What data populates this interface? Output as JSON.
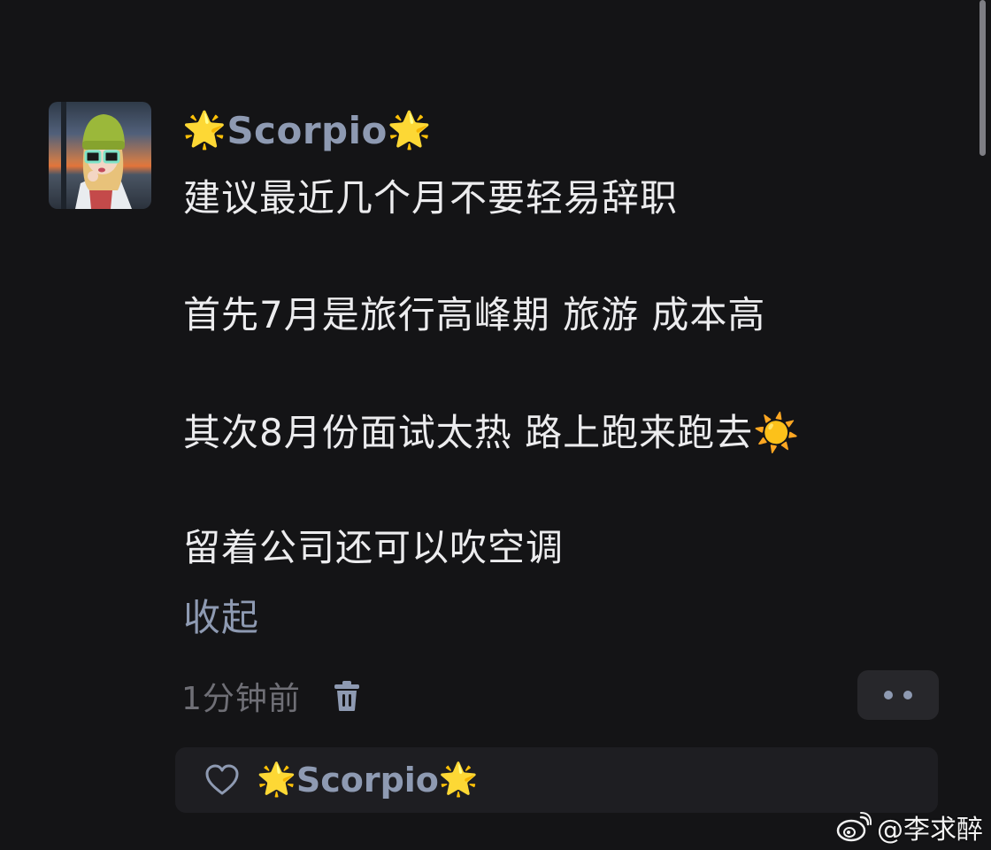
{
  "comment": {
    "username": "Scorpio",
    "username_prefix_emoji": "🌟",
    "username_suffix_emoji": "🌟",
    "lines": [
      "建议最近几个月不要轻易辞职",
      "首先7月是旅行高峰期 旅游 成本高",
      "其次8月份面试太热 路上跑来跑去☀️",
      "留着公司还可以吹空调"
    ],
    "collapse_label": "收起",
    "timestamp": "1分钟前",
    "delete_icon": "trash-icon",
    "more_icon": "more-dots-icon"
  },
  "reply_bar": {
    "like_icon": "heart-outline-icon",
    "name": "Scorpio",
    "name_prefix_emoji": "🌟",
    "name_suffix_emoji": "🌟"
  },
  "watermark": {
    "logo_icon": "weibo-logo-icon",
    "text": "@李求醉"
  },
  "colors": {
    "background": "#141416",
    "text_primary": "#ececee",
    "accent_blue_gray": "#8e9ab2",
    "text_muted": "#6f6f76",
    "button_bg": "#27272b",
    "reply_bar_bg": "#1e1e22"
  }
}
